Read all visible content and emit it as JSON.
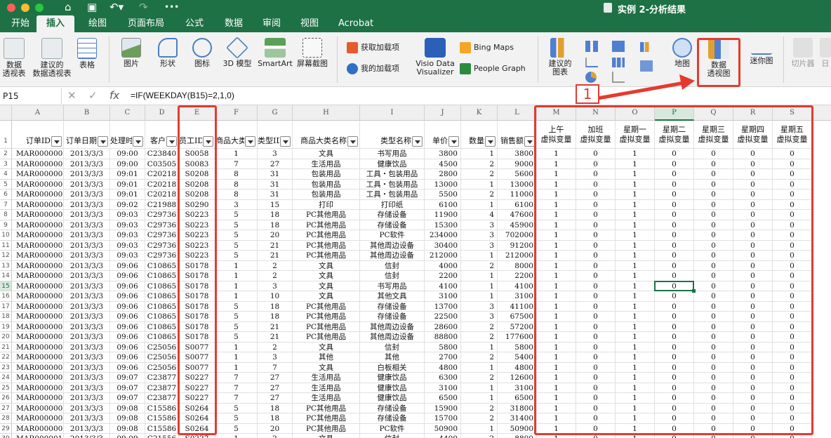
{
  "window": {
    "title": "实例 2-分析结果"
  },
  "tabs": [
    "开始",
    "插入",
    "绘图",
    "页面布局",
    "公式",
    "数据",
    "审阅",
    "视图",
    "Acrobat"
  ],
  "active_tab": "插入",
  "ribbon": {
    "pivot_table": "数据\n透视表",
    "recommended_pivot": "建议的\n数据透视表",
    "table": "表格",
    "pictures": "图片",
    "shapes": "形状",
    "icons": "图标",
    "models_3d": "3D 模型",
    "smartart": "SmartArt",
    "screenshot": "屏幕截图",
    "get_addins": "获取加载项",
    "my_addins": "我的加载项",
    "visio": "Visio Data\nVisualizer",
    "bing_maps": "Bing Maps",
    "people_graph": "People Graph",
    "recommended_charts": "建议的\n图表",
    "maps": "地图",
    "pivot_chart": "数据\n透视图",
    "sparklines": "迷你图",
    "slicer": "切片器",
    "timeline": "日"
  },
  "formula_bar": {
    "name_box": "P15",
    "fx": "fx",
    "formula": "=IF(WEEKDAY(B15)=2,1,0)"
  },
  "annotation_number": "1",
  "columns": [
    "A",
    "B",
    "C",
    "D",
    "E",
    "F",
    "G",
    "H",
    "I",
    "J",
    "K",
    "L",
    "M",
    "N",
    "O",
    "P",
    "Q",
    "R",
    "S"
  ],
  "selected_column": "P",
  "selected_row": 15,
  "headers": [
    "订单ID",
    "订单日期",
    "处理时间",
    "客户",
    "员工ID",
    "商品大类",
    "类型ID",
    "商品大类名称",
    "类型名称",
    "单价",
    "数量",
    "销售额"
  ],
  "dummy_headers": [
    "上午\n虚拟变量",
    "加班\n虚拟变量",
    "星期一\n虚拟变量",
    "星期二\n虚拟变量",
    "星期三\n虚拟变量",
    "星期四\n虚拟变量",
    "星期五\n虚拟变量"
  ],
  "rows": [
    [
      "MAR0000001",
      "2013/3/3",
      "09:00",
      "C23840",
      "S0058",
      "1",
      "3",
      "文具",
      "书写用品",
      "3800",
      "1",
      "3800",
      "1",
      "0",
      "1",
      "0",
      "0",
      "0",
      "0"
    ],
    [
      "MAR0000002",
      "2013/3/3",
      "09:00",
      "C03505",
      "S0083",
      "7",
      "27",
      "生活用品",
      "健康饮品",
      "4500",
      "2",
      "9000",
      "1",
      "0",
      "1",
      "0",
      "0",
      "0",
      "0"
    ],
    [
      "MAR0000003",
      "2013/3/3",
      "09:01",
      "C20218",
      "S0208",
      "8",
      "31",
      "包装用品",
      "工具・包装用品",
      "2800",
      "2",
      "5600",
      "1",
      "0",
      "1",
      "0",
      "0",
      "0",
      "0"
    ],
    [
      "MAR0000003",
      "2013/3/3",
      "09:01",
      "C20218",
      "S0208",
      "8",
      "31",
      "包装用品",
      "工具・包装用品",
      "13000",
      "1",
      "13000",
      "1",
      "0",
      "1",
      "0",
      "0",
      "0",
      "0"
    ],
    [
      "MAR0000003",
      "2013/3/3",
      "09:01",
      "C20218",
      "S0208",
      "8",
      "31",
      "包装用品",
      "工具・包装用品",
      "5500",
      "2",
      "11000",
      "1",
      "0",
      "1",
      "0",
      "0",
      "0",
      "0"
    ],
    [
      "MAR0000004",
      "2013/3/3",
      "09:02",
      "C21988",
      "S0290",
      "3",
      "15",
      "打印",
      "打印纸",
      "6100",
      "1",
      "6100",
      "1",
      "0",
      "1",
      "0",
      "0",
      "0",
      "0"
    ],
    [
      "MAR0000005",
      "2013/3/3",
      "09:03",
      "C29736",
      "S0223",
      "5",
      "18",
      "PC其他用品",
      "存储设备",
      "11900",
      "4",
      "47600",
      "1",
      "0",
      "1",
      "0",
      "0",
      "0",
      "0"
    ],
    [
      "MAR0000005",
      "2013/3/3",
      "09:03",
      "C29736",
      "S0223",
      "5",
      "18",
      "PC其他用品",
      "存储设备",
      "15300",
      "3",
      "45900",
      "1",
      "0",
      "1",
      "0",
      "0",
      "0",
      "0"
    ],
    [
      "MAR0000005",
      "2013/3/3",
      "09:03",
      "C29736",
      "S0223",
      "5",
      "20",
      "PC其他用品",
      "PC软件",
      "234000",
      "3",
      "702000",
      "1",
      "0",
      "1",
      "0",
      "0",
      "0",
      "0"
    ],
    [
      "MAR0000005",
      "2013/3/3",
      "09:03",
      "C29736",
      "S0223",
      "5",
      "21",
      "PC其他用品",
      "其他周边设备",
      "30400",
      "3",
      "91200",
      "1",
      "0",
      "1",
      "0",
      "0",
      "0",
      "0"
    ],
    [
      "MAR0000005",
      "2013/3/3",
      "09:03",
      "C29736",
      "S0223",
      "5",
      "21",
      "PC其他用品",
      "其他周边设备",
      "212000",
      "1",
      "212000",
      "1",
      "0",
      "1",
      "0",
      "0",
      "0",
      "0"
    ],
    [
      "MAR0000006",
      "2013/3/3",
      "09:06",
      "C10865",
      "S0178",
      "1",
      "2",
      "文具",
      "信封",
      "4000",
      "2",
      "8000",
      "1",
      "0",
      "1",
      "0",
      "0",
      "0",
      "0"
    ],
    [
      "MAR0000006",
      "2013/3/3",
      "09:06",
      "C10865",
      "S0178",
      "1",
      "2",
      "文具",
      "信封",
      "2200",
      "1",
      "2200",
      "1",
      "0",
      "1",
      "0",
      "0",
      "0",
      "0"
    ],
    [
      "MAR0000006",
      "2013/3/3",
      "09:06",
      "C10865",
      "S0178",
      "1",
      "3",
      "文具",
      "书写用品",
      "4100",
      "1",
      "4100",
      "1",
      "0",
      "1",
      "0",
      "0",
      "0",
      "0"
    ],
    [
      "MAR0000006",
      "2013/3/3",
      "09:06",
      "C10865",
      "S0178",
      "1",
      "10",
      "文具",
      "其他文具",
      "3100",
      "1",
      "3100",
      "1",
      "0",
      "1",
      "0",
      "0",
      "0",
      "0"
    ],
    [
      "MAR0000006",
      "2013/3/3",
      "09:06",
      "C10865",
      "S0178",
      "5",
      "18",
      "PC其他用品",
      "存储设备",
      "13700",
      "3",
      "41100",
      "1",
      "0",
      "1",
      "0",
      "0",
      "0",
      "0"
    ],
    [
      "MAR0000006",
      "2013/3/3",
      "09:06",
      "C10865",
      "S0178",
      "5",
      "18",
      "PC其他用品",
      "存储设备",
      "22500",
      "3",
      "67500",
      "1",
      "0",
      "1",
      "0",
      "0",
      "0",
      "0"
    ],
    [
      "MAR0000006",
      "2013/3/3",
      "09:06",
      "C10865",
      "S0178",
      "5",
      "21",
      "PC其他用品",
      "其他周边设备",
      "28600",
      "2",
      "57200",
      "1",
      "0",
      "1",
      "0",
      "0",
      "0",
      "0"
    ],
    [
      "MAR0000006",
      "2013/3/3",
      "09:06",
      "C10865",
      "S0178",
      "5",
      "21",
      "PC其他用品",
      "其他周边设备",
      "88800",
      "2",
      "177600",
      "1",
      "0",
      "1",
      "0",
      "0",
      "0",
      "0"
    ],
    [
      "MAR0000007",
      "2013/3/3",
      "09:06",
      "C25056",
      "S0077",
      "1",
      "2",
      "文具",
      "信封",
      "5800",
      "1",
      "5800",
      "1",
      "0",
      "1",
      "0",
      "0",
      "0",
      "0"
    ],
    [
      "MAR0000007",
      "2013/3/3",
      "09:06",
      "C25056",
      "S0077",
      "1",
      "3",
      "其他",
      "其他",
      "2700",
      "2",
      "5400",
      "1",
      "0",
      "1",
      "0",
      "0",
      "0",
      "0"
    ],
    [
      "MAR0000007",
      "2013/3/3",
      "09:06",
      "C25056",
      "S0077",
      "1",
      "7",
      "文具",
      "白板相关",
      "4800",
      "1",
      "4800",
      "1",
      "0",
      "1",
      "0",
      "0",
      "0",
      "0"
    ],
    [
      "MAR0000008",
      "2013/3/3",
      "09:07",
      "C23877",
      "S0227",
      "7",
      "27",
      "生活用品",
      "健康饮品",
      "6300",
      "2",
      "12600",
      "1",
      "0",
      "1",
      "0",
      "0",
      "0",
      "0"
    ],
    [
      "MAR0000008",
      "2013/3/3",
      "09:07",
      "C23877",
      "S0227",
      "7",
      "27",
      "生活用品",
      "健康饮品",
      "3100",
      "1",
      "3100",
      "1",
      "0",
      "1",
      "0",
      "0",
      "0",
      "0"
    ],
    [
      "MAR0000008",
      "2013/3/3",
      "09:07",
      "C23877",
      "S0227",
      "7",
      "27",
      "生活用品",
      "健康饮品",
      "6500",
      "1",
      "6500",
      "1",
      "0",
      "1",
      "0",
      "0",
      "0",
      "0"
    ],
    [
      "MAR0000009",
      "2013/3/3",
      "09:08",
      "C15586",
      "S0264",
      "5",
      "18",
      "PC其他用品",
      "存储设备",
      "15900",
      "2",
      "31800",
      "1",
      "0",
      "1",
      "0",
      "0",
      "0",
      "0"
    ],
    [
      "MAR0000009",
      "2013/3/3",
      "09:08",
      "C15586",
      "S0264",
      "5",
      "18",
      "PC其他用品",
      "存储设备",
      "15700",
      "2",
      "31400",
      "1",
      "0",
      "1",
      "0",
      "0",
      "0",
      "0"
    ],
    [
      "MAR0000009",
      "2013/3/3",
      "09:08",
      "C15586",
      "S0264",
      "5",
      "20",
      "PC其他用品",
      "PC软件",
      "50900",
      "1",
      "50900",
      "1",
      "0",
      "1",
      "0",
      "0",
      "0",
      "0"
    ],
    [
      "MAR0000010",
      "2013/3/3",
      "09:09",
      "C21556",
      "S0227",
      "1",
      "2",
      "文具",
      "信封",
      "4400",
      "2",
      "8800",
      "1",
      "0",
      "1",
      "0",
      "0",
      "0",
      "0"
    ]
  ]
}
